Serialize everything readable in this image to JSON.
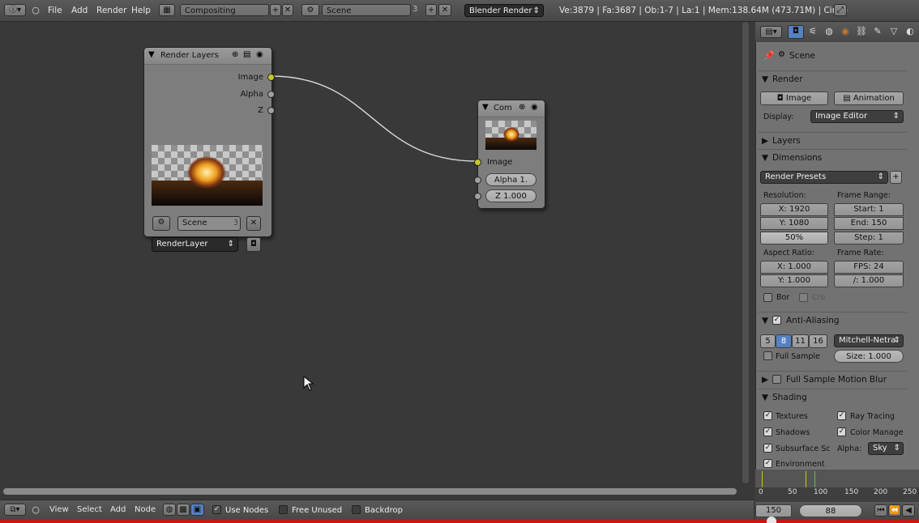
{
  "topbar": {
    "menus": [
      "File",
      "Add",
      "Render",
      "Help"
    ],
    "layout_name": "Compositing",
    "scene_name": "Scene",
    "scene_users": "3",
    "render_engine": "Blender Render",
    "stats": "Ve:3879 | Fa:3687 | Ob:1-7 | La:1 | Mem:138.64M (473.71M) | Circle"
  },
  "nodes": {
    "render_layers": {
      "title": "Render Layers",
      "outputs": [
        "Image",
        "Alpha",
        "Z"
      ],
      "scene": "Scene",
      "scene_users": "3",
      "layer": "RenderLayer"
    },
    "composite": {
      "title": "Com",
      "input_image": "Image",
      "alpha": "Alpha 1.",
      "z": "Z 1.000"
    }
  },
  "bottombar": {
    "menus": [
      "View",
      "Select",
      "Add",
      "Node"
    ],
    "use_nodes": "Use Nodes",
    "free_unused": "Free Unused",
    "backdrop": "Backdrop"
  },
  "properties": {
    "context": "Scene",
    "render": {
      "title": "Render",
      "image_btn": "Image",
      "animation_btn": "Animation",
      "display_label": "Display:",
      "display_value": "Image Editor"
    },
    "layers_title": "Layers",
    "dimensions": {
      "title": "Dimensions",
      "presets": "Render Presets",
      "resolution_label": "Resolution:",
      "res_x": "X: 1920",
      "res_y": "Y: 1080",
      "res_pct": "50%",
      "frame_range_label": "Frame Range:",
      "start": "Start: 1",
      "end": "End: 150",
      "step": "Step: 1",
      "aspect_label": "Aspect Ratio:",
      "aspect_x": "X: 1.000",
      "aspect_y": "Y: 1.000",
      "frame_rate_label": "Frame Rate:",
      "fps": "FPS: 24",
      "fps_base": "/: 1.000",
      "border": "Bor",
      "crop": "Cro"
    },
    "antialiasing": {
      "title": "Anti-Aliasing",
      "samples": [
        "5",
        "8",
        "11",
        "16"
      ],
      "active_sample": "8",
      "filter": "Mitchell-Netra",
      "full_sample": "Full Sample",
      "size": "Size: 1.000"
    },
    "motion_blur_title": "Full Sample Motion Blur",
    "shading": {
      "title": "Shading",
      "textures": "Textures",
      "ray_tracing": "Ray Tracing",
      "shadows": "Shadows",
      "color_manage": "Color Manage",
      "subsurface": "Subsurface Sc",
      "alpha_label": "Alpha:",
      "alpha_value": "Sky",
      "environment": "Environment"
    }
  },
  "timeline": {
    "ticks": [
      "0",
      "50",
      "100",
      "150",
      "200",
      "250"
    ],
    "end_frame": "150",
    "current_frame": "88"
  },
  "colors": {
    "socket_image": "#c7c729",
    "socket_value": "#a0a0a0",
    "active_sample": "#5680c2",
    "progress_bar": "#cc1414"
  }
}
